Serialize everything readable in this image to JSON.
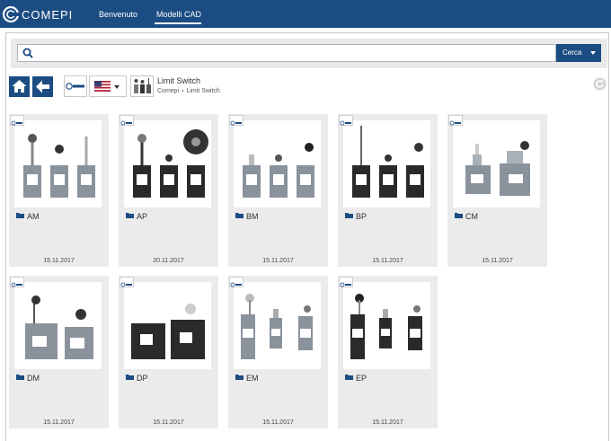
{
  "header": {
    "logo_text": "COMEPI",
    "nav": [
      {
        "label": "Benvenuto"
      },
      {
        "label": "Modelli CAD"
      }
    ]
  },
  "search": {
    "placeholder": "",
    "button_label": "Cerca"
  },
  "toolbar": {
    "home_icon": "home-icon",
    "back_icon": "arrow-left-icon",
    "language_flag": "us-flag-icon"
  },
  "breadcrumb": {
    "title": "Limit Switch",
    "path": [
      "Comepi",
      "Limit Switch"
    ]
  },
  "colors": {
    "brand": "#1b4c82",
    "card_bg": "#ebebeb",
    "switch_body": "#8a929c",
    "switch_black": "#2a2a2a"
  },
  "cards": [
    {
      "name": "AM",
      "date": "15.11.2017"
    },
    {
      "name": "AP",
      "date": "20.11.2017"
    },
    {
      "name": "BM",
      "date": "15.11.2017"
    },
    {
      "name": "BP",
      "date": "15.11.2017"
    },
    {
      "name": "CM",
      "date": "15.11.2017"
    },
    {
      "name": "DM",
      "date": "15.11.2017"
    },
    {
      "name": "DP",
      "date": "15.11.2017"
    },
    {
      "name": "EM",
      "date": "15.11.2017"
    },
    {
      "name": "EP",
      "date": "15.11.2017"
    }
  ]
}
